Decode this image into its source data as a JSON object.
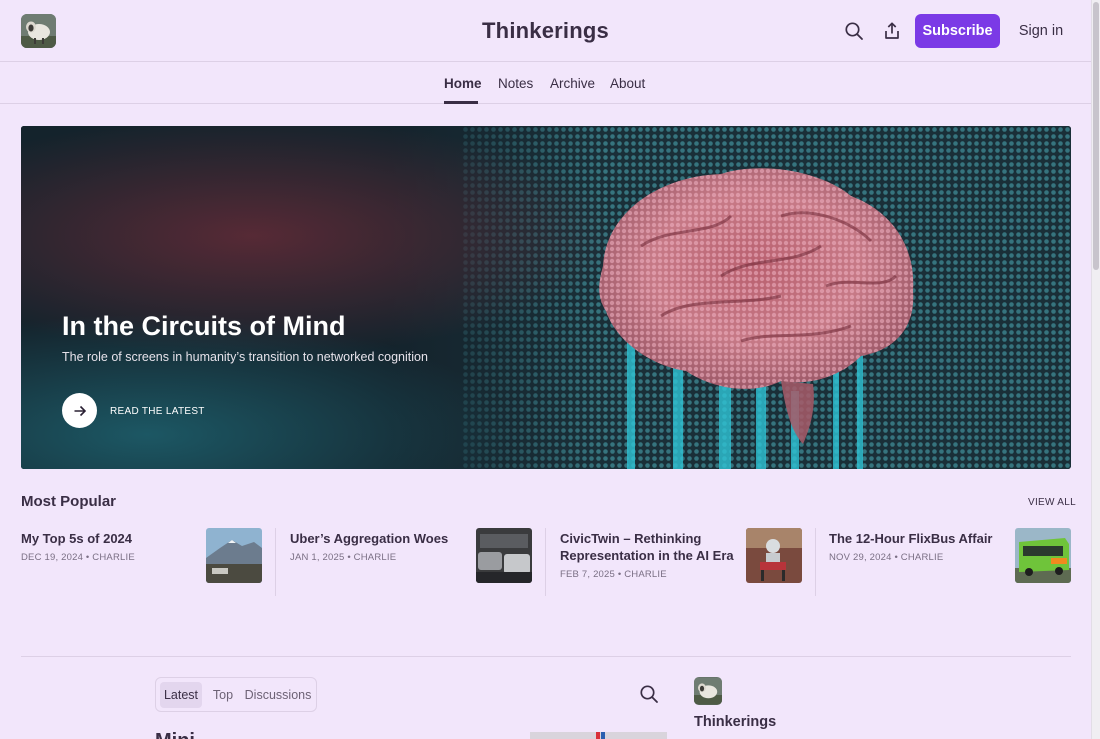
{
  "header": {
    "site_title": "Thinkerings",
    "subscribe_label": "Subscribe",
    "signin_label": "Sign in",
    "icons": [
      "sheep-logo",
      "search-icon",
      "share-icon"
    ]
  },
  "nav": {
    "items": [
      {
        "label": "Home",
        "active": true
      },
      {
        "label": "Notes"
      },
      {
        "label": "Archive"
      },
      {
        "label": "About"
      }
    ]
  },
  "hero": {
    "title": "In the Circuits of Mind",
    "subtitle": "The role of screens in humanity’s transition to networked cognition",
    "cta": "READ THE LATEST",
    "image": "brain-illustration"
  },
  "most_popular": {
    "heading": "Most Popular",
    "view_all": "VIEW ALL",
    "posts": [
      {
        "title": "My Top 5s of 2024",
        "date": "DEC 19, 2024",
        "author": "CHARLIE",
        "meta": "DEC 19, 2024 • CHARLIE",
        "thumb": "mountain-landscape"
      },
      {
        "title": "Uber’s Aggregation Woes",
        "date": "JAN 1, 2025",
        "author": "CHARLIE",
        "meta": "JAN 1, 2025 • CHARLIE",
        "thumb": "street-traffic"
      },
      {
        "title": "CivicTwin – Rethinking Representation in the AI Era",
        "title_line1": "CivicTwin – Rethinking",
        "title_line2": "Representation in the AI Era",
        "date": "FEB 7, 2025",
        "author": "CHARLIE",
        "meta": "FEB 7, 2025 • CHARLIE",
        "thumb": "robot-on-chair"
      },
      {
        "title": "The 12-Hour FlixBus Affair",
        "date": "NOV 29, 2024",
        "author": "CHARLIE",
        "meta": "NOV 29, 2024 • CHARLIE",
        "thumb": "green-bus"
      }
    ]
  },
  "feed": {
    "tabs": [
      {
        "label": "Latest",
        "active": true
      },
      {
        "label": "Top"
      },
      {
        "label": "Discussions"
      }
    ],
    "partial_post_title": "Mini"
  },
  "sidebar": {
    "title": "Thinkerings"
  },
  "colors": {
    "background": "#f2e6fb",
    "accent": "#7b3ae6",
    "text": "#3a2e45"
  }
}
